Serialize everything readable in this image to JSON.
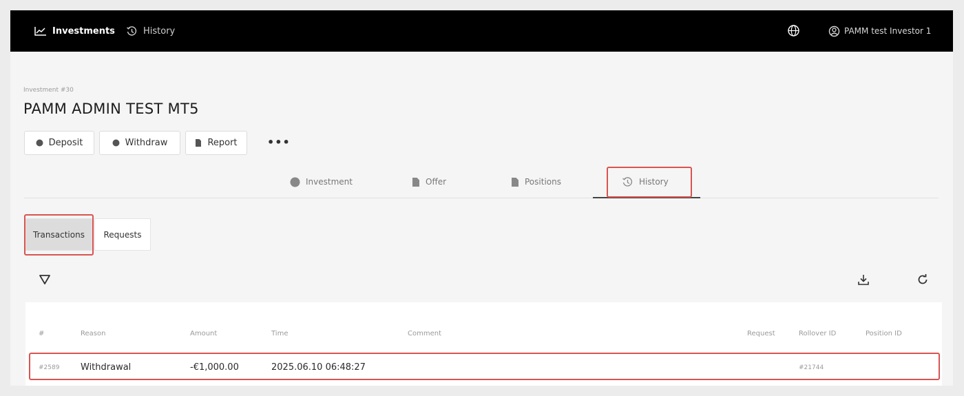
{
  "nav": {
    "investments_label": "Investments",
    "history_label": "History",
    "user_label": "PAMM test Investor 1"
  },
  "header": {
    "subtitle": "Investment #30",
    "title": "PAMM ADMIN TEST MT5"
  },
  "actions": {
    "deposit": "Deposit",
    "withdraw": "Withdraw",
    "report": "Report",
    "more": "•••"
  },
  "tabs": {
    "investment": "Investment",
    "offer": "Offer",
    "positions": "Positions",
    "history": "History"
  },
  "subtabs": {
    "transactions": "Transactions",
    "requests": "Requests"
  },
  "table": {
    "columns": {
      "id": "#",
      "reason": "Reason",
      "amount": "Amount",
      "time": "Time",
      "comment": "Comment",
      "request": "Request",
      "rollover_id": "Rollover ID",
      "position_id": "Position ID"
    },
    "rows": [
      {
        "id": "#2589",
        "reason": "Withdrawal",
        "amount": "-€1,000.00",
        "time": "2025.06.10 06:48:27",
        "comment": "",
        "request": "",
        "rollover_id": "#21744",
        "position_id": ""
      }
    ]
  },
  "colors": {
    "topbar": "#000000",
    "highlight": "#d9534f",
    "background": "#f5f5f5"
  },
  "icons": [
    "chart-line-icon",
    "history-icon",
    "globe-icon",
    "user-circle-icon",
    "coin-icon",
    "document-icon",
    "filter-icon",
    "download-icon",
    "refresh-icon"
  ]
}
